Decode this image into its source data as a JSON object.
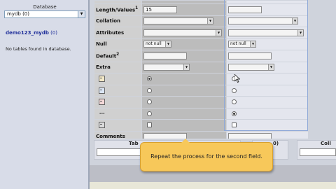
{
  "sidebar": {
    "database_label": "Database",
    "database_selected": "mydb (0)",
    "db_link": "demo123_mydb",
    "db_link_count": "(0)",
    "no_tables_text": "No tables found in database."
  },
  "fields_form": {
    "rows": [
      {
        "label": "Length/Values",
        "label_sup": "1",
        "c1_value": "15",
        "c2_value": ""
      },
      {
        "label": "Collation",
        "c1_select": "",
        "c2_select": ""
      },
      {
        "label": "Attributes",
        "c1_select": "",
        "c2_select": ""
      },
      {
        "label": "Null",
        "c1_select": "not null",
        "c2_select": "not null"
      },
      {
        "label": "Default",
        "label_sup": "2",
        "c1_value": "",
        "c2_value": ""
      },
      {
        "label": "Extra",
        "c1_select": "",
        "c2_select": ""
      },
      {
        "label": "",
        "icon": "primary-key-icon",
        "c1_radio": "on",
        "c2_radio": "off"
      },
      {
        "label": "",
        "icon": "index-icon",
        "c1_radio": "off",
        "c2_radio": "off"
      },
      {
        "label": "",
        "icon": "unique-icon",
        "c1_radio": "off",
        "c2_radio": "off"
      },
      {
        "label": "---",
        "c1_radio": "off",
        "c2_radio": "on"
      },
      {
        "label": "",
        "icon": "fulltext-icon",
        "c1_check": false,
        "c2_check": false
      },
      {
        "label": "Comments",
        "c1_value": "",
        "c2_value": ""
      }
    ]
  },
  "lower": {
    "table_label_partial": "Tab",
    "right_label_partial": "Coll",
    "mid_label_partial": "0)"
  },
  "tooltip": {
    "text": "Repeat the process for the second field."
  }
}
